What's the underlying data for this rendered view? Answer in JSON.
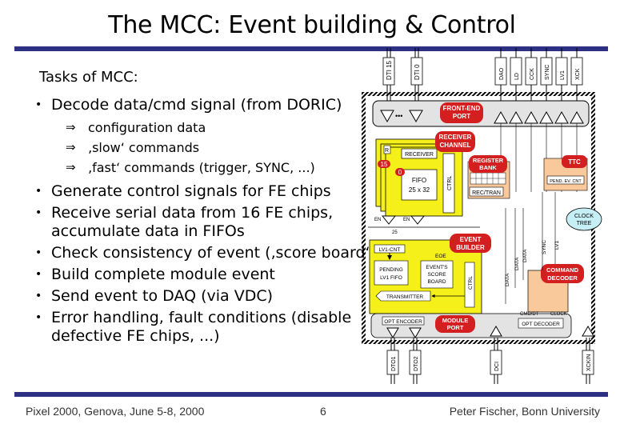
{
  "slide": {
    "title": "The MCC: Event building & Control",
    "colors": {
      "rule": "#2e3083",
      "yellow": "#f5ef1a",
      "peach": "#f9c99b",
      "red_label": "#d31f1f",
      "port_gray": "#e3e3e3",
      "clock_tree": "#c6eef5"
    }
  },
  "tasks": {
    "heading": "Tasks of MCC:",
    "bullet_icon": "•",
    "arrow_icon": "⇒",
    "items": [
      {
        "text": "Decode data/cmd signal (from DORIC)",
        "sub": [
          "configuration data",
          "‚slow‘ commands",
          "‚fast‘ commands (trigger, SYNC, ...)"
        ]
      },
      {
        "text": "Generate control signals for FE chips"
      },
      {
        "text": "Receive serial data from 16 FE chips, accumulate data in FIFOs"
      },
      {
        "text": "Check consistency of event (‚score board‘)"
      },
      {
        "text": "Build complete module event"
      },
      {
        "text": "Send event to DAQ (via VDC)"
      },
      {
        "text": "Error handling, fault conditions (disable defective FE chips, ...)"
      }
    ]
  },
  "diagram": {
    "top_pins_left": [
      "DTI 15",
      "DTI 0"
    ],
    "top_pins_right": [
      "DAO",
      "LD",
      "CCK",
      "SYNC",
      "LV1",
      "XCK"
    ],
    "bottom_pins": [
      "DTO1",
      "DTO2",
      "DCI",
      "XCKIN"
    ],
    "front_end_port": [
      "FRONT-END",
      "PORT"
    ],
    "receiver_channel": [
      "RECEIVER",
      "CHANNEL"
    ],
    "receiver": "RECEIVER",
    "r_short": "R",
    "ctrl": "CTRL",
    "fifo": [
      "FIFO",
      "25 x 32"
    ],
    "channel_hi": "15",
    "channel_lo": "0",
    "en": "EN",
    "bus_width": "25",
    "register_bank": [
      "REGISTER",
      "BANK"
    ],
    "rec_tran": "REC/TRAN",
    "ttc": "TTC",
    "pend_ev_cnt": "PEND. EV. CNT",
    "clock_tree": [
      "CLOCK",
      "TREE"
    ],
    "event_builder": [
      "EVENT",
      "BUILDER"
    ],
    "lv1_cnt": "LV1-CNT",
    "eoe": "EOE",
    "pending_fifo": [
      "PENDING",
      "LV1 FIFO"
    ],
    "score_board": [
      "EVENT'S",
      "SCORE",
      "BOARD"
    ],
    "transmitter": "TRANSMITTER",
    "command_decoder": [
      "COMMAND",
      "DECODER"
    ],
    "decoder_signals": [
      "DATA",
      "DATA",
      "DATA",
      "SYNC",
      "LV1"
    ],
    "opt_encoder": "OPT ENCODER",
    "module_port": [
      "MODULE",
      "PORT"
    ],
    "cmd_dt": "CMD/DT",
    "clock": "CLOCK",
    "opt_decoder": "OPT DECODER",
    "dots": "•••"
  },
  "footer": {
    "left": "Pixel 2000, Genova, June 5-8, 2000",
    "page": "6",
    "right": "Peter Fischer, Bonn University"
  }
}
